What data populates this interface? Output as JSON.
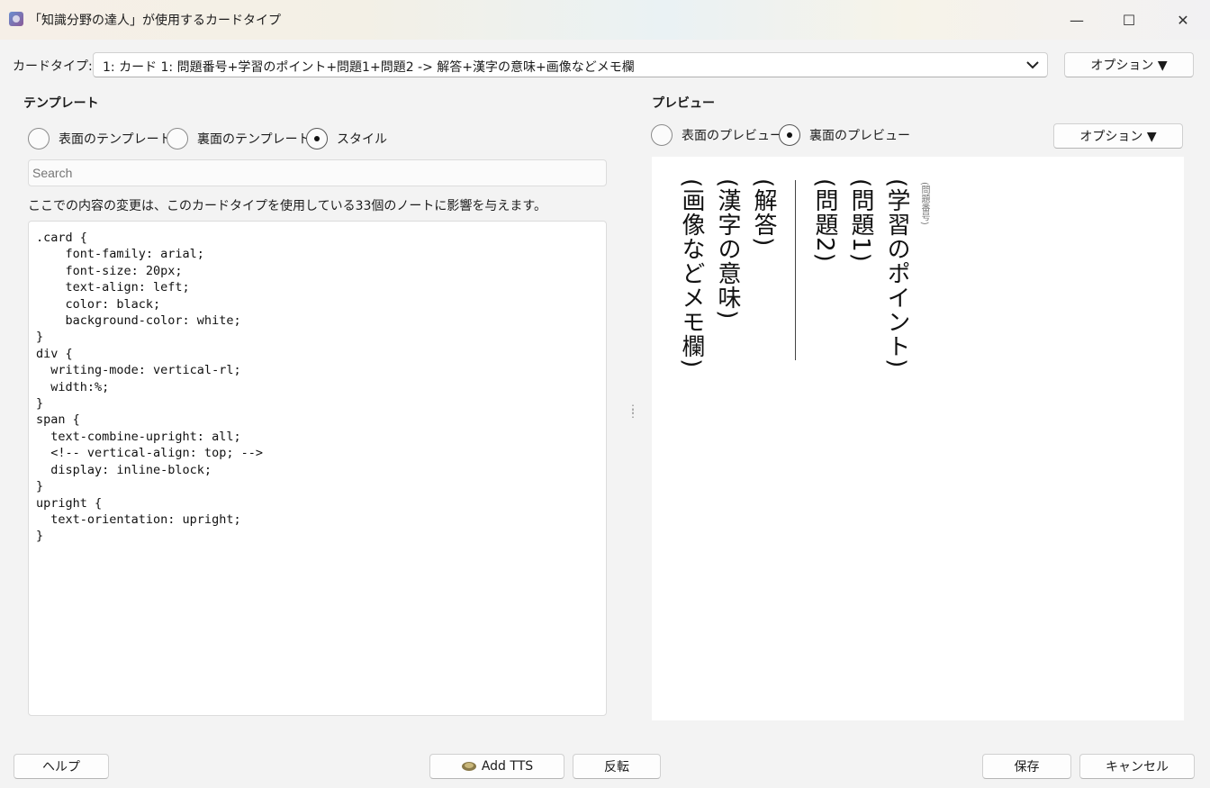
{
  "window": {
    "title": "「知識分野の達人」が使用するカードタイプ",
    "minimize": "—",
    "maximize": "☐",
    "close": "✕"
  },
  "card_type": {
    "label": "カードタイプ:",
    "selected": "1: カード 1: 問題番号+学習のポイント+問題1+問題2 -> 解答+漢字の意味+画像などメモ欄",
    "options_button": "オプション ▼"
  },
  "template": {
    "title": "テンプレート",
    "radios": [
      {
        "label": "表面のテンプレート",
        "checked": false
      },
      {
        "label": "裏面のテンプレート",
        "checked": false
      },
      {
        "label": "スタイル",
        "checked": true
      }
    ],
    "search_placeholder": "Search",
    "note": "ここでの内容の変更は、このカードタイプを使用している33個のノートに影響を与えます。",
    "code": ".card {\n    font-family: arial;\n    font-size: 20px;\n    text-align: left;\n    color: black;\n    background-color: white;\n}\ndiv {\n  writing-mode: vertical-rl;\n  width:%;\n}\nspan {\n  text-combine-upright: all;\n  <!-- vertical-align: top; -->\n  display: inline-block;\n}\nupright {\n  text-orientation: upright;\n}"
  },
  "preview": {
    "title": "プレビュー",
    "radios": [
      {
        "label": "表面のプレビュー",
        "checked": false
      },
      {
        "label": "裏面のプレビュー",
        "checked": true
      }
    ],
    "options_button": "オプション ▼",
    "small_label": "(問題番号)",
    "columns": [
      "(学習のポイント)",
      "(問題1)",
      "(問題2)",
      "(解答)",
      "(漢字の意味)",
      "(画像などメモ欄)"
    ]
  },
  "footer": {
    "help": "ヘルプ",
    "add_tts": "Add TTS",
    "flip": "反転",
    "save": "保存",
    "cancel": "キャンセル"
  }
}
